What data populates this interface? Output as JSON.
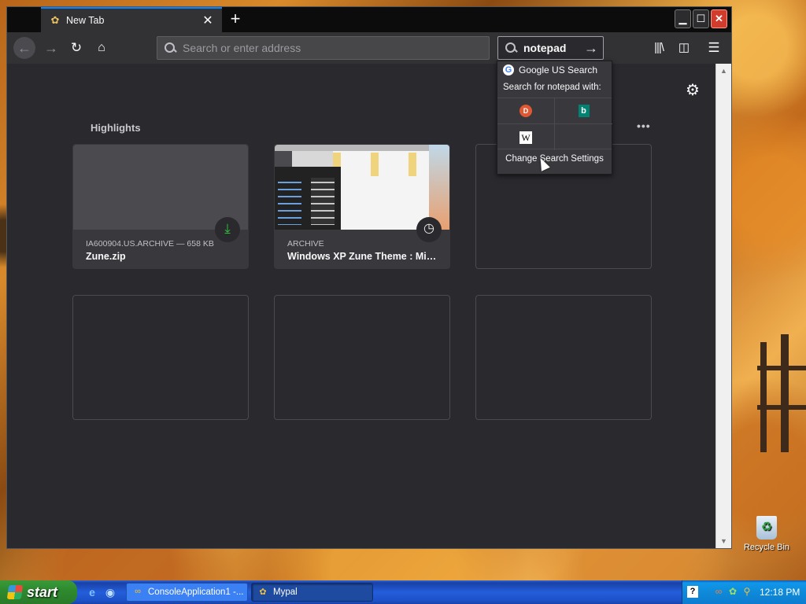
{
  "browser": {
    "tab": {
      "title": "New Tab",
      "close_glyph": "✕"
    },
    "newtab_glyph": "+",
    "window_controls": {
      "minimize": "▁",
      "maximize": "☐",
      "close": "✕"
    },
    "nav": {
      "back": "←",
      "forward": "→",
      "reload": "↻",
      "home": "⌂"
    },
    "urlbar": {
      "placeholder": "Search or enter address",
      "value": ""
    },
    "searchbar": {
      "value": "notepad",
      "go_glyph": "→"
    },
    "toolbar": {
      "library": "|||\\",
      "sidebar": "◫",
      "menu": "☰"
    }
  },
  "newtab": {
    "settings_glyph": "⚙",
    "highlights_title": "Highlights",
    "more_glyph": "•••",
    "cards": [
      {
        "meta": "IA600904.US.ARCHIVE — 658 KB",
        "title": "Zune.zip",
        "badge": "⤓",
        "badge_type": "download"
      },
      {
        "meta": "ARCHIVE",
        "title": "Windows XP Zune Theme : Micr...",
        "badge": "◷",
        "badge_type": "history"
      }
    ]
  },
  "search_popup": {
    "engine_name": "Google US Search",
    "google_glyph": "G",
    "search_for_label": "Search for notepad with:",
    "engines": [
      {
        "name": "DuckDuckGo",
        "glyph": "D"
      },
      {
        "name": "Bing",
        "glyph": "b"
      },
      {
        "name": "Wikipedia",
        "glyph": "W"
      }
    ],
    "settings_label": "Change Search Settings"
  },
  "taskbar": {
    "start_label": "start",
    "quicklaunch": [
      "e",
      "◉"
    ],
    "items": [
      {
        "label": "ConsoleApplication1 -...",
        "icon": "∞",
        "active": false
      },
      {
        "label": "Mypal",
        "icon": "✿",
        "active": true
      }
    ],
    "tray": {
      "help": "?",
      "icons": [
        "∞",
        "✿",
        "⚲"
      ],
      "clock": "12:18 PM"
    }
  },
  "desktop": {
    "icons": [
      {
        "label": "Recycle Bin",
        "glyph": "♻"
      }
    ]
  },
  "colors": {
    "accent": "#0a84ff",
    "content_bg": "#2a2a2e",
    "toolbar_bg": "#323234",
    "xp_start_green": "#2e8b2e"
  }
}
